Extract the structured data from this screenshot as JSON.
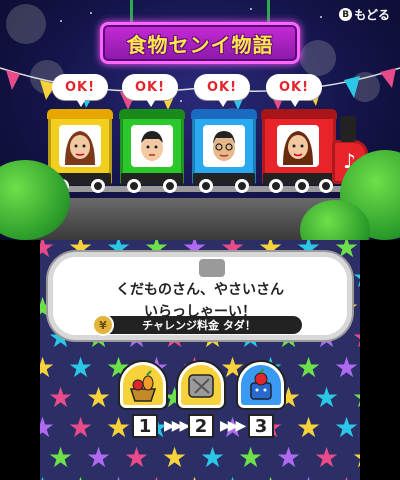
{
  "header": {
    "title": "食物センイ物語",
    "back_button_glyph": "B",
    "back_label": "もどる"
  },
  "train": {
    "cars": [
      {
        "status": "OK!",
        "color": "#f2cf1e",
        "roof": "#e6a800",
        "passenger": "mii-woman-brown-hair"
      },
      {
        "status": "OK!",
        "color": "#2cc72a",
        "roof": "#1a8a1a",
        "passenger": "mii-man-black-hair"
      },
      {
        "status": "OK!",
        "color": "#2aa8f0",
        "roof": "#1a6ac0",
        "passenger": "mii-man-glasses"
      },
      {
        "status": "OK!",
        "color": "#e8242a",
        "roof": "#a81418",
        "passenger": "mii-woman-brown-hair-locomotive"
      }
    ],
    "locomotive_icon": "music-note-icon"
  },
  "message": {
    "line1": "くだものさん、やさいさん",
    "line2": "いらっしゃーい！",
    "fee": "チャレンジ料金 タダ！",
    "coin_icon": "coin-icon"
  },
  "steps": [
    {
      "number": "1",
      "icon": "fruit-basket-icon",
      "color": "#f7d23a"
    },
    {
      "number": "2",
      "icon": "juicer-icon",
      "color": "#f7d23a"
    },
    {
      "number": "3",
      "icon": "vegetable-bin-icon",
      "color": "#3a9af2"
    }
  ],
  "step_arrow": "▶▶▶"
}
